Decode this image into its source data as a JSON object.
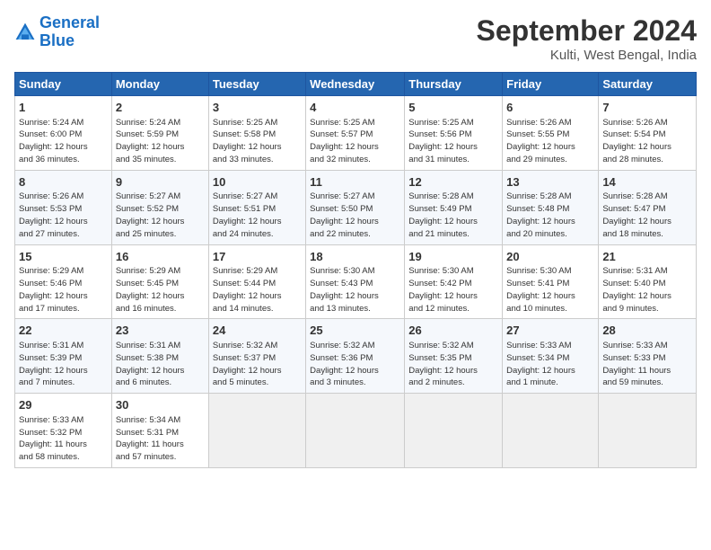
{
  "logo": {
    "line1": "General",
    "line2": "Blue"
  },
  "title": "September 2024",
  "location": "Kulti, West Bengal, India",
  "days_of_week": [
    "Sunday",
    "Monday",
    "Tuesday",
    "Wednesday",
    "Thursday",
    "Friday",
    "Saturday"
  ],
  "weeks": [
    [
      {
        "day": 1,
        "info": "Sunrise: 5:24 AM\nSunset: 6:00 PM\nDaylight: 12 hours\nand 36 minutes."
      },
      {
        "day": 2,
        "info": "Sunrise: 5:24 AM\nSunset: 5:59 PM\nDaylight: 12 hours\nand 35 minutes."
      },
      {
        "day": 3,
        "info": "Sunrise: 5:25 AM\nSunset: 5:58 PM\nDaylight: 12 hours\nand 33 minutes."
      },
      {
        "day": 4,
        "info": "Sunrise: 5:25 AM\nSunset: 5:57 PM\nDaylight: 12 hours\nand 32 minutes."
      },
      {
        "day": 5,
        "info": "Sunrise: 5:25 AM\nSunset: 5:56 PM\nDaylight: 12 hours\nand 31 minutes."
      },
      {
        "day": 6,
        "info": "Sunrise: 5:26 AM\nSunset: 5:55 PM\nDaylight: 12 hours\nand 29 minutes."
      },
      {
        "day": 7,
        "info": "Sunrise: 5:26 AM\nSunset: 5:54 PM\nDaylight: 12 hours\nand 28 minutes."
      }
    ],
    [
      {
        "day": 8,
        "info": "Sunrise: 5:26 AM\nSunset: 5:53 PM\nDaylight: 12 hours\nand 27 minutes."
      },
      {
        "day": 9,
        "info": "Sunrise: 5:27 AM\nSunset: 5:52 PM\nDaylight: 12 hours\nand 25 minutes."
      },
      {
        "day": 10,
        "info": "Sunrise: 5:27 AM\nSunset: 5:51 PM\nDaylight: 12 hours\nand 24 minutes."
      },
      {
        "day": 11,
        "info": "Sunrise: 5:27 AM\nSunset: 5:50 PM\nDaylight: 12 hours\nand 22 minutes."
      },
      {
        "day": 12,
        "info": "Sunrise: 5:28 AM\nSunset: 5:49 PM\nDaylight: 12 hours\nand 21 minutes."
      },
      {
        "day": 13,
        "info": "Sunrise: 5:28 AM\nSunset: 5:48 PM\nDaylight: 12 hours\nand 20 minutes."
      },
      {
        "day": 14,
        "info": "Sunrise: 5:28 AM\nSunset: 5:47 PM\nDaylight: 12 hours\nand 18 minutes."
      }
    ],
    [
      {
        "day": 15,
        "info": "Sunrise: 5:29 AM\nSunset: 5:46 PM\nDaylight: 12 hours\nand 17 minutes."
      },
      {
        "day": 16,
        "info": "Sunrise: 5:29 AM\nSunset: 5:45 PM\nDaylight: 12 hours\nand 16 minutes."
      },
      {
        "day": 17,
        "info": "Sunrise: 5:29 AM\nSunset: 5:44 PM\nDaylight: 12 hours\nand 14 minutes."
      },
      {
        "day": 18,
        "info": "Sunrise: 5:30 AM\nSunset: 5:43 PM\nDaylight: 12 hours\nand 13 minutes."
      },
      {
        "day": 19,
        "info": "Sunrise: 5:30 AM\nSunset: 5:42 PM\nDaylight: 12 hours\nand 12 minutes."
      },
      {
        "day": 20,
        "info": "Sunrise: 5:30 AM\nSunset: 5:41 PM\nDaylight: 12 hours\nand 10 minutes."
      },
      {
        "day": 21,
        "info": "Sunrise: 5:31 AM\nSunset: 5:40 PM\nDaylight: 12 hours\nand 9 minutes."
      }
    ],
    [
      {
        "day": 22,
        "info": "Sunrise: 5:31 AM\nSunset: 5:39 PM\nDaylight: 12 hours\nand 7 minutes."
      },
      {
        "day": 23,
        "info": "Sunrise: 5:31 AM\nSunset: 5:38 PM\nDaylight: 12 hours\nand 6 minutes."
      },
      {
        "day": 24,
        "info": "Sunrise: 5:32 AM\nSunset: 5:37 PM\nDaylight: 12 hours\nand 5 minutes."
      },
      {
        "day": 25,
        "info": "Sunrise: 5:32 AM\nSunset: 5:36 PM\nDaylight: 12 hours\nand 3 minutes."
      },
      {
        "day": 26,
        "info": "Sunrise: 5:32 AM\nSunset: 5:35 PM\nDaylight: 12 hours\nand 2 minutes."
      },
      {
        "day": 27,
        "info": "Sunrise: 5:33 AM\nSunset: 5:34 PM\nDaylight: 12 hours\nand 1 minute."
      },
      {
        "day": 28,
        "info": "Sunrise: 5:33 AM\nSunset: 5:33 PM\nDaylight: 11 hours\nand 59 minutes."
      }
    ],
    [
      {
        "day": 29,
        "info": "Sunrise: 5:33 AM\nSunset: 5:32 PM\nDaylight: 11 hours\nand 58 minutes."
      },
      {
        "day": 30,
        "info": "Sunrise: 5:34 AM\nSunset: 5:31 PM\nDaylight: 11 hours\nand 57 minutes."
      },
      null,
      null,
      null,
      null,
      null
    ]
  ]
}
